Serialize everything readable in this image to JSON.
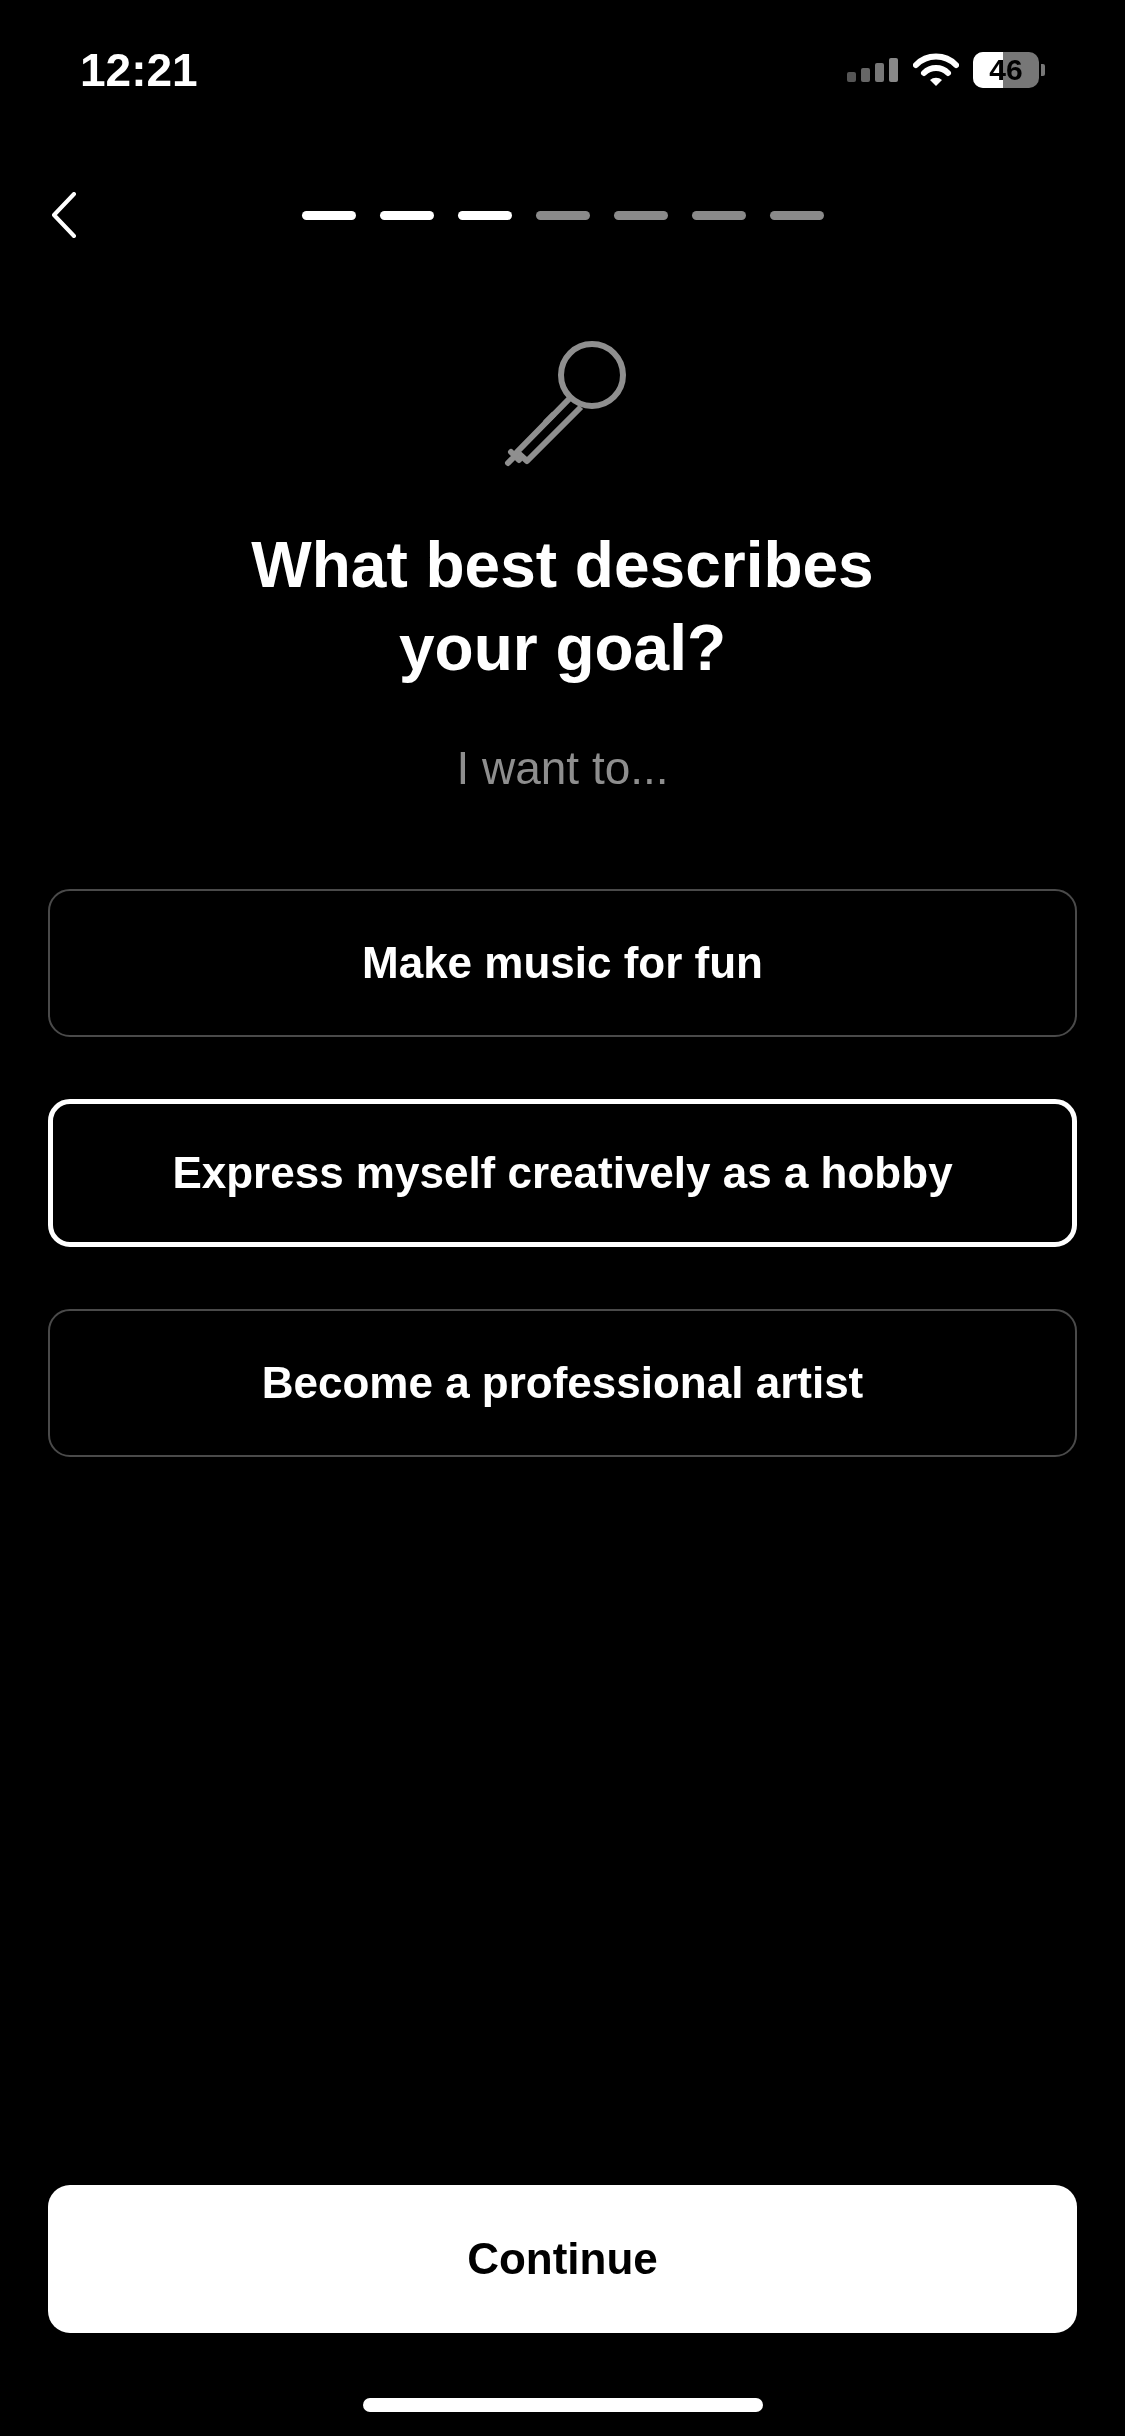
{
  "status_bar": {
    "time": "12:21",
    "battery": "46"
  },
  "progress": [
    {
      "done": true
    },
    {
      "done": true
    },
    {
      "done": true
    },
    {
      "done": false
    },
    {
      "done": false
    },
    {
      "done": false
    },
    {
      "done": false
    }
  ],
  "title": "What best describes your goal?",
  "subtitle": "I want to...",
  "options": [
    {
      "label": "Make music for fun",
      "selected": false
    },
    {
      "label": "Express myself creatively as a hobby",
      "selected": true
    },
    {
      "label": "Become a professional artist",
      "selected": false
    }
  ],
  "continue_button": "Continue"
}
